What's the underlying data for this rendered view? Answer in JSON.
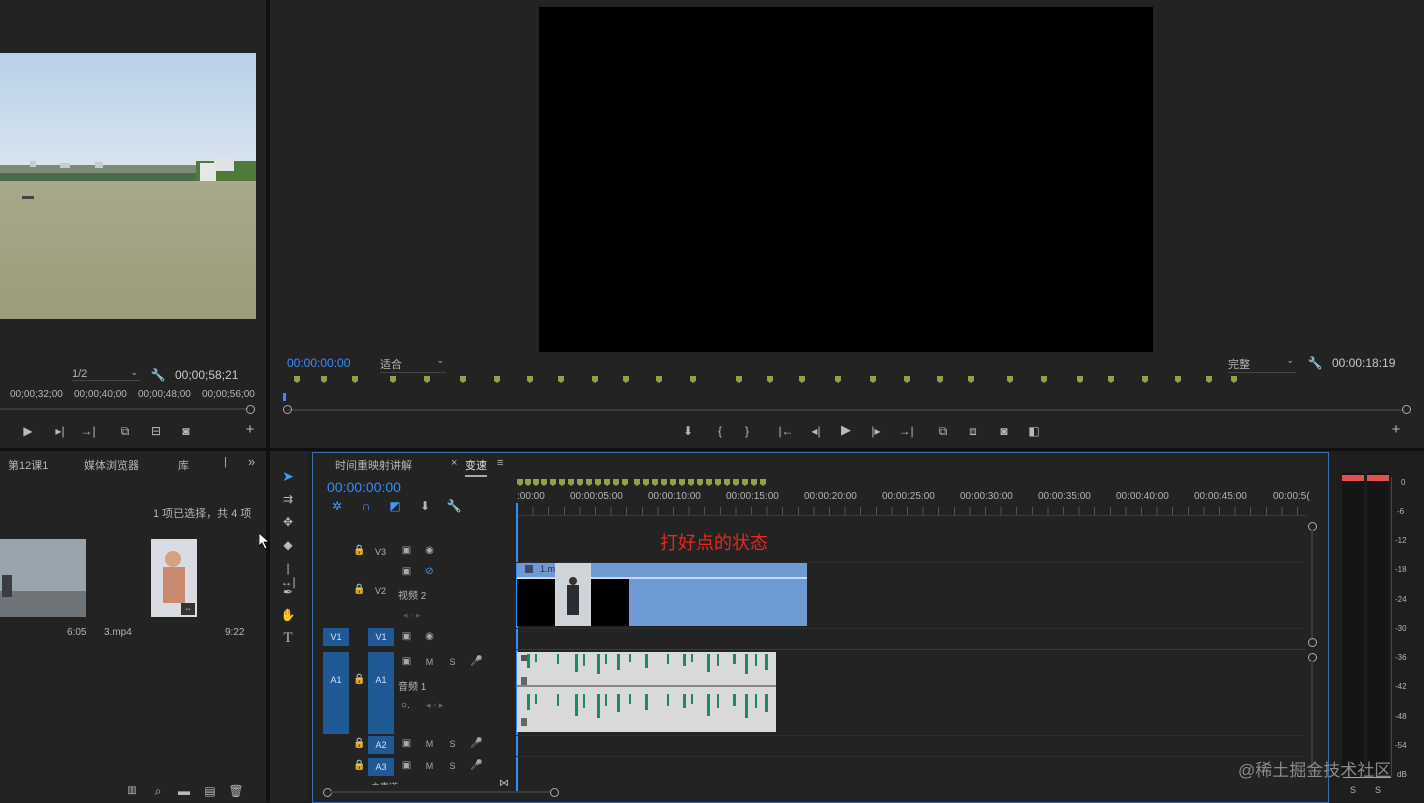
{
  "source_monitor": {
    "fit_label": "1/2",
    "duration": "00;00;58;21",
    "ruler": [
      "00;00;32;00",
      "00;00;40;00",
      "00;00;48;00",
      "00;00;56;00"
    ]
  },
  "program_monitor": {
    "timecode": "00:00:00:00",
    "fit_label": "适合",
    "quality_label": "完整",
    "duration": "00:00:18:19"
  },
  "project_panel": {
    "tabs": [
      "第12课1",
      "媒体浏览器",
      "库"
    ],
    "selection_status": "1 项已选择，共 4 项",
    "items": [
      {
        "duration": "6:05"
      },
      {
        "name": "3.mp4",
        "duration": "9:22"
      }
    ]
  },
  "timeline": {
    "tabs": [
      "时间重映射讲解",
      "变速"
    ],
    "timecode": "00:00:00:00",
    "ruler_labels": [
      ":00:00",
      "00:00:05:00",
      "00:00:10:00",
      "00:00:15:00",
      "00:00:20:00",
      "00:00:25:00",
      "00:00:30:00",
      "00:00:35:00",
      "00:00:40:00",
      "00:00:45:00",
      "00:00:5("
    ],
    "annotation": "打好点的状态",
    "annotation_color": "#e8281e",
    "tracks": {
      "v3": "V3",
      "v2": "V2",
      "v2_name": "视频 2",
      "v1": "V1",
      "v1_src": "V1",
      "a1": "A1",
      "a1_src": "A1",
      "a1_name": "音频 1",
      "a2": "A2",
      "a3": "A3",
      "master": "主声道",
      "mute": "M",
      "solo": "S"
    },
    "video_clip": {
      "name": "1.mp4",
      "color": "#6e9ad4"
    },
    "audio_clip_color": "#d9d9d9",
    "waveform_color": "#1a8a66"
  },
  "audio_meter": {
    "labels": [
      "0",
      "-6",
      "-12",
      "-18",
      "-24",
      "-30",
      "-36",
      "-42",
      "-48",
      "-54",
      "dB"
    ],
    "solo_labels": [
      "S",
      "S"
    ]
  },
  "watermark": "@稀土掘金技术社区"
}
